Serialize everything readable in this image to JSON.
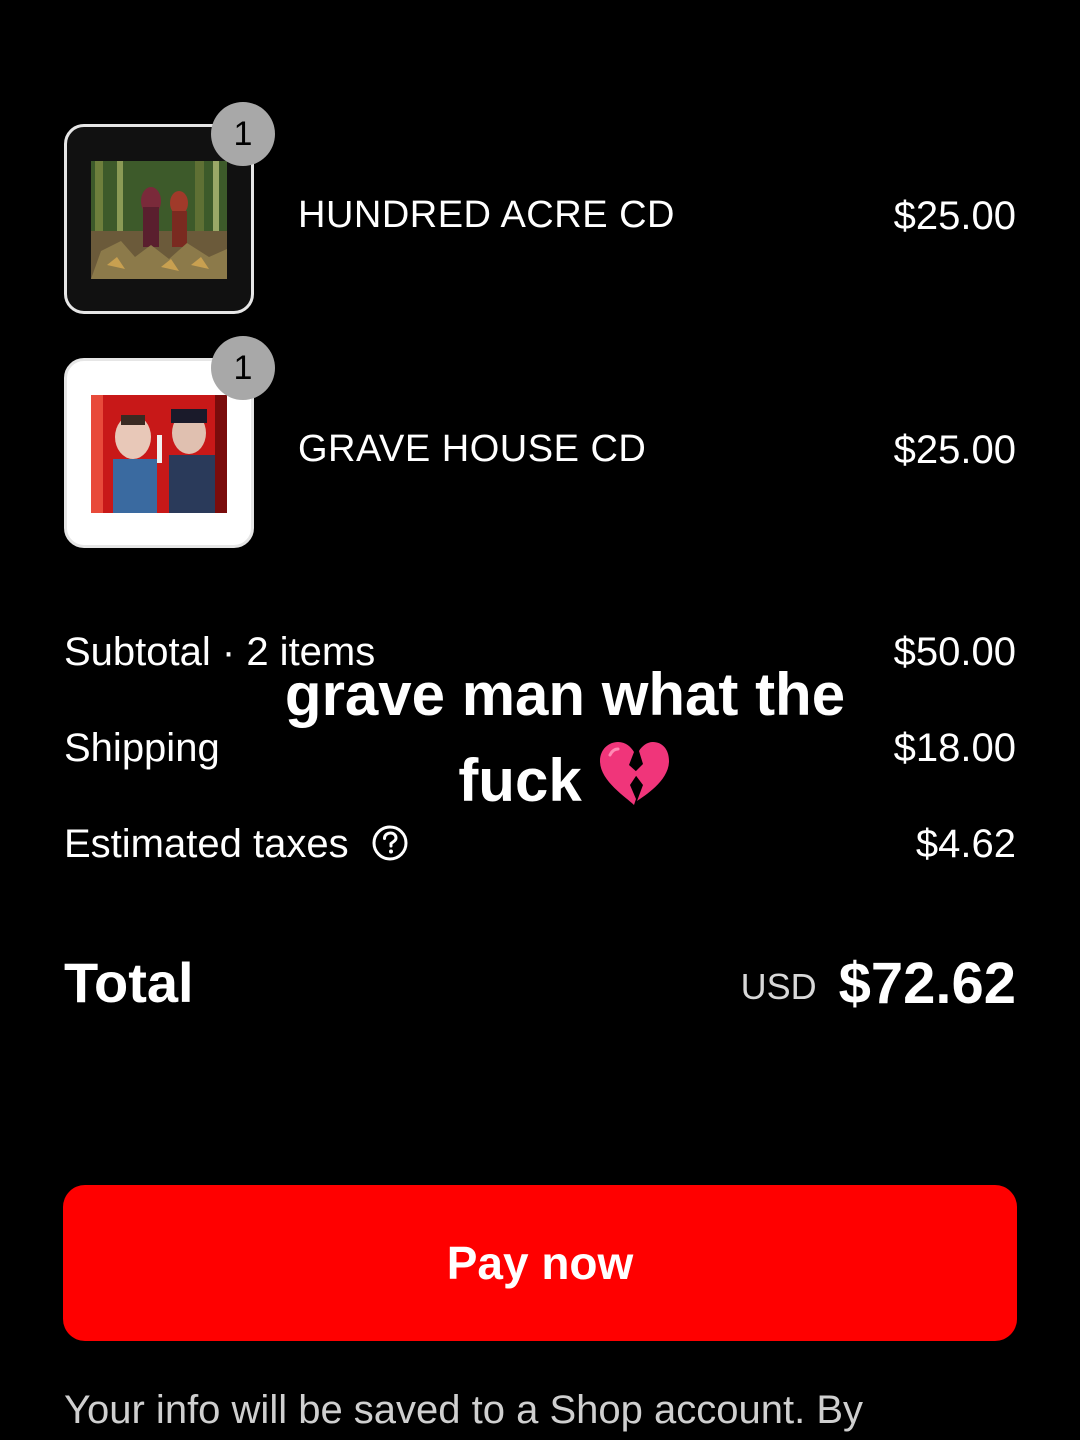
{
  "line_items": [
    {
      "quantity": "1",
      "name": "HUNDRED ACRE CD",
      "price": "$25.00",
      "thumbnail": "album-cover-forest"
    },
    {
      "quantity": "1",
      "name": "GRAVE HOUSE CD",
      "price": "$25.00",
      "thumbnail": "album-cover-red-room"
    }
  ],
  "summary": {
    "subtotal_label": "Subtotal · 2 items",
    "subtotal_value": "$50.00",
    "shipping_label": "Shipping",
    "shipping_value": "$18.00",
    "taxes_label": "Estimated taxes",
    "taxes_value": "$4.62",
    "taxes_help_icon": "question-circle-icon"
  },
  "total": {
    "label": "Total",
    "currency": "USD",
    "amount": "$72.62"
  },
  "pay_button": {
    "label": "Pay now",
    "color": "#ff0000"
  },
  "footer_note": "Your info will be saved to a Shop account. By",
  "overlay": {
    "line1": "grave man what the",
    "line2": "fuck",
    "emoji_icon": "broken-heart-icon"
  }
}
